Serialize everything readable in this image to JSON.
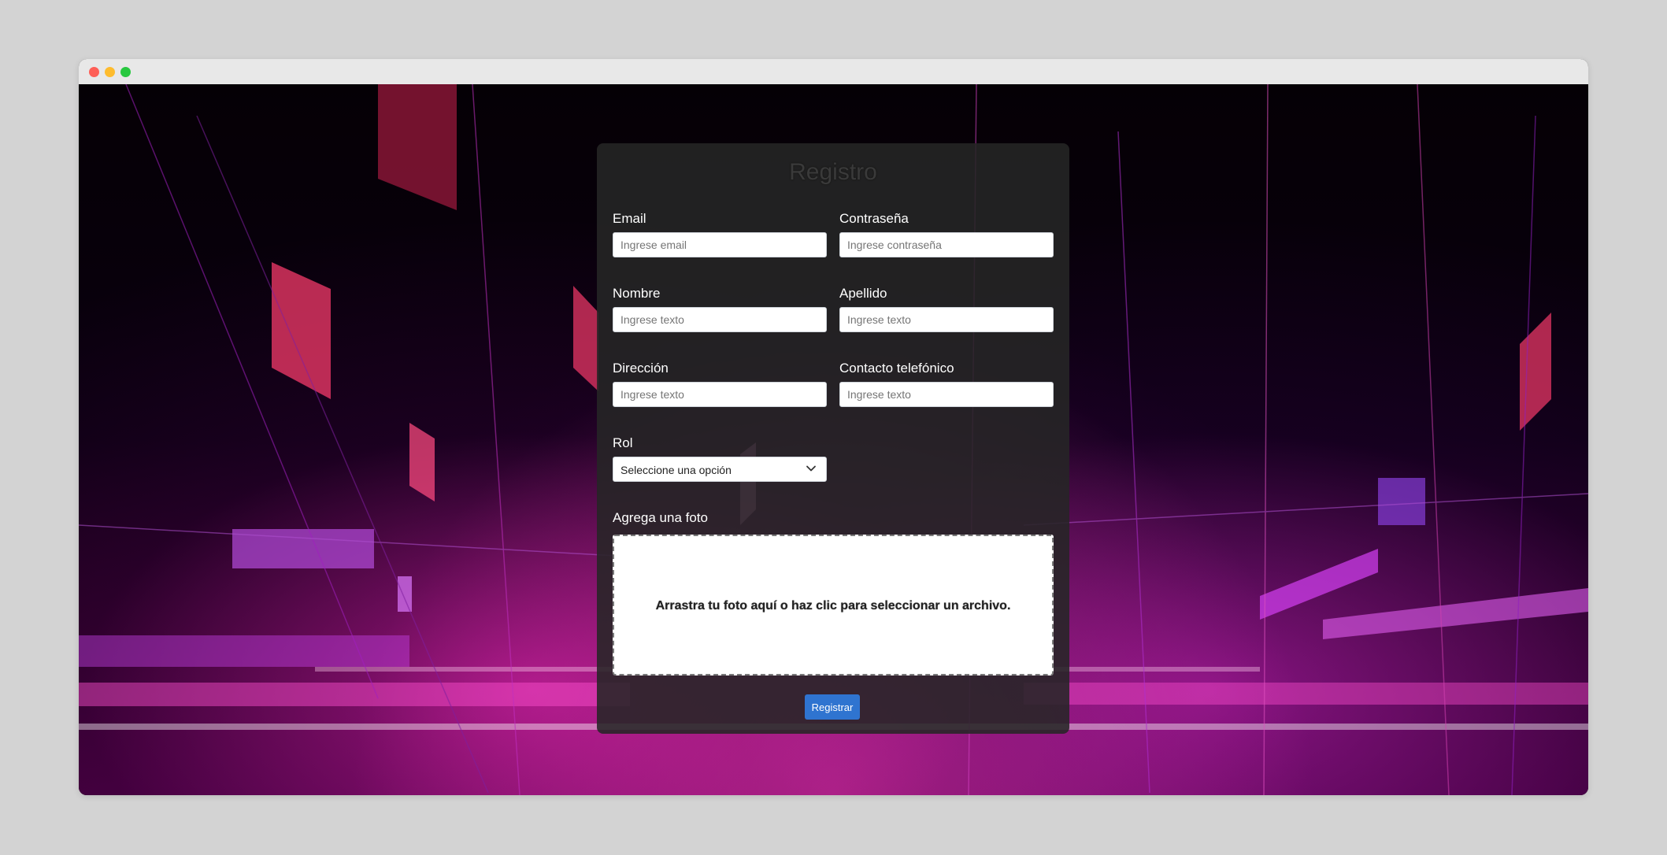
{
  "window": {
    "controls": [
      "close-dot",
      "minimize-dot",
      "maximize-dot"
    ]
  },
  "form": {
    "title": "Registro",
    "email": {
      "label": "Email",
      "placeholder": "Ingrese email"
    },
    "password": {
      "label": "Contraseña",
      "placeholder": "Ingrese contraseña"
    },
    "first_name": {
      "label": "Nombre",
      "placeholder": "Ingrese texto"
    },
    "last_name": {
      "label": "Apellido",
      "placeholder": "Ingrese texto"
    },
    "address": {
      "label": "Dirección",
      "placeholder": "Ingrese texto"
    },
    "phone": {
      "label": "Contacto telefónico",
      "placeholder": "Ingrese texto"
    },
    "role": {
      "label": "Rol",
      "selected": "Seleccione una opción",
      "icon": "chevron-down-icon"
    },
    "photo": {
      "label": "Agrega una foto",
      "dropzone_text": "Arrastra tu foto aquí o haz clic para seleccionar un archivo."
    },
    "submit_label": "Registrar"
  },
  "colors": {
    "page_background": "#d3d3d3",
    "panel": "#262626",
    "submit_button": "#2f74d0",
    "accent_magenta": "#ff3fd0"
  }
}
